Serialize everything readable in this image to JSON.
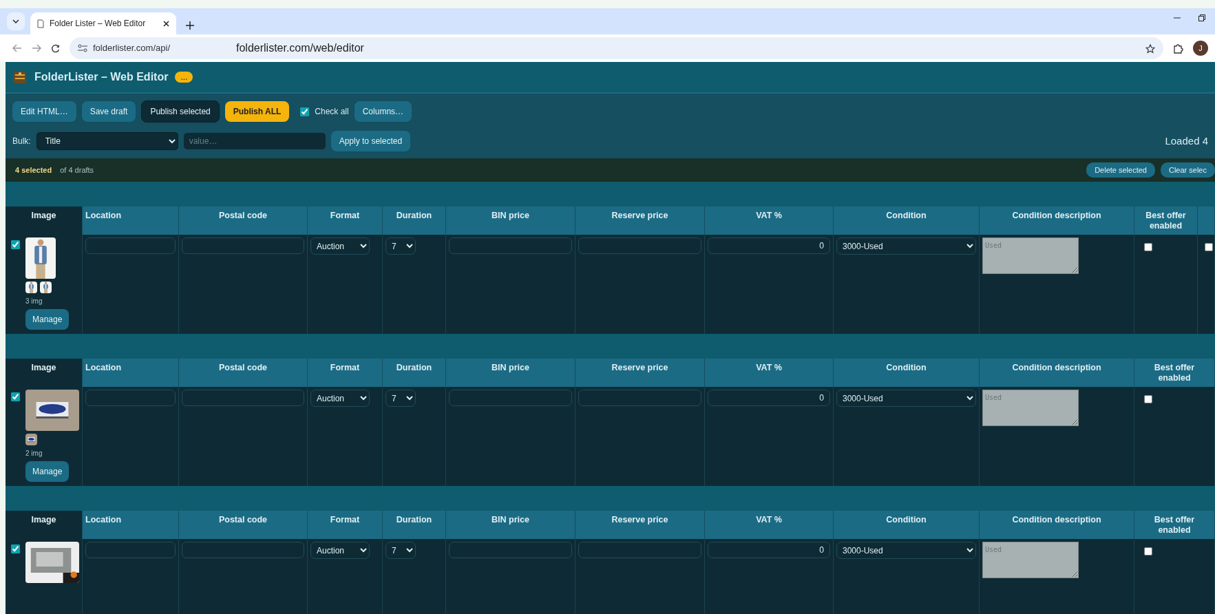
{
  "browser": {
    "tab_title": "Folder Lister – Web Editor",
    "url_behind": "folderlister.com/api/",
    "url": "folderlister.com/web/editor",
    "profile": "J"
  },
  "app": {
    "title": "FolderLister – Web Editor",
    "badge": "..."
  },
  "toolbar": [
    {
      "label": "Edit HTML…",
      "kind": "default"
    },
    {
      "label": "Save draft",
      "kind": "default"
    },
    {
      "label": "Publish selected",
      "kind": "dark"
    },
    {
      "label": "Publish ALL",
      "kind": "warning"
    },
    {
      "label": "Check all",
      "kind": "checkbox",
      "checked": true
    },
    {
      "label": "Columns…",
      "kind": "default"
    }
  ],
  "bulk": {
    "label": "Bulk:",
    "field": "Title",
    "placeholder": "value…",
    "apply": "Apply to selected",
    "status": "Loaded 4"
  },
  "selection": {
    "count": "4 selected",
    "total": "of 4 drafts",
    "actions": [
      "Delete selected",
      "Clear selec"
    ]
  },
  "drafts": [
    {
      "columns": [
        "Image",
        "Location",
        "Postal code",
        "Format",
        "Duration",
        "BIN price",
        "Reserve price",
        "VAT %",
        "Condition",
        "Condition description",
        "Best offer enabled"
      ],
      "selected": true,
      "image_count": "3 img",
      "manage": "Manage",
      "format": "Auction",
      "duration": "7",
      "vat": "0",
      "condition": "3000-Used",
      "condition_placeholder": "Used",
      "best_offer": false,
      "column_12": false
    },
    {
      "columns": [
        "Image",
        "Location",
        "Postal code",
        "Format",
        "Duration",
        "BIN price",
        "Reserve price",
        "VAT %",
        "Condition",
        "Condition description",
        "Best offer enabled"
      ],
      "selected": true,
      "image_count": "2 img",
      "manage": "Manage",
      "format": "Auction",
      "duration": "7",
      "vat": "0",
      "condition": "3000-Used",
      "condition_placeholder": "Used",
      "best_offer": false
    },
    {
      "columns": [
        "Image",
        "Location",
        "Postal code",
        "Format",
        "Duration",
        "BIN price",
        "Reserve price",
        "VAT %",
        "Condition",
        "Condition description",
        "Best offer enabled"
      ],
      "selected": true,
      "format": "Auction",
      "duration": "7",
      "vat": "0",
      "condition": "3000-Used",
      "condition_placeholder": "Used",
      "best_offer": false
    }
  ]
}
